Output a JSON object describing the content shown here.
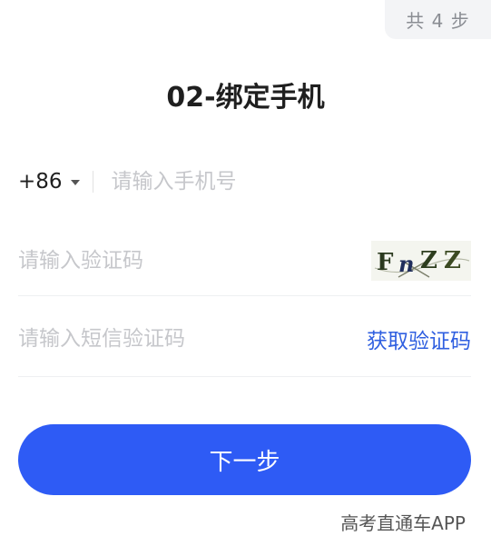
{
  "header": {
    "step_count": "共 4 步",
    "title": "02-绑定手机"
  },
  "phone": {
    "country_code": "+86",
    "placeholder": "请输入手机号"
  },
  "captcha": {
    "placeholder": "请输入验证码",
    "image_text": "FnZZ"
  },
  "sms": {
    "placeholder": "请输入短信验证码",
    "get_code_label": "获取验证码"
  },
  "actions": {
    "next_label": "下一步"
  },
  "watermark": {
    "text": "高考直通车APP"
  },
  "colors": {
    "accent": "#2e5bf5",
    "link": "#2f5fe0",
    "placeholder": "#c6c7cb"
  }
}
